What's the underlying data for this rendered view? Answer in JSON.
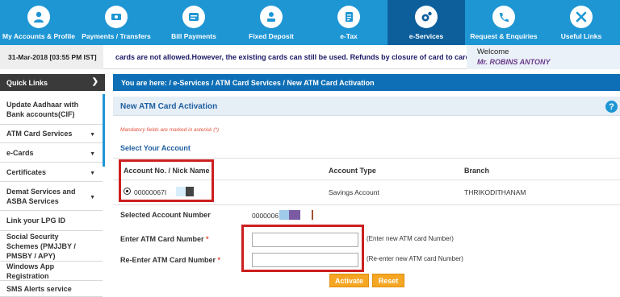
{
  "nav": [
    {
      "label": "My Accounts & Profile",
      "icon": "user-icon"
    },
    {
      "label": "Payments / Transfers",
      "icon": "money-transfer-icon"
    },
    {
      "label": "Bill Payments",
      "icon": "bill-icon"
    },
    {
      "label": "Fixed Deposit",
      "icon": "deposit-icon"
    },
    {
      "label": "e-Tax",
      "icon": "tax-document-icon"
    },
    {
      "label": "e-Services",
      "icon": "e-services-icon"
    },
    {
      "label": "Request & Enquiries",
      "icon": "phone-enquiry-icon"
    },
    {
      "label": "Useful Links",
      "icon": "links-icon"
    }
  ],
  "infobar": {
    "datetime": "31-Mar-2018 [03:55 PM IST]",
    "marquee": "cards are not allowed.However, the existing cards can still be used. Refunds by closure of card to card",
    "welcome_label": "Welcome",
    "user_name": "Mr. ROBINS ANTONY"
  },
  "sidebar": {
    "header": "Quick Links",
    "items": [
      {
        "label": "Update Aadhaar with Bank accounts(CIF)",
        "has_caret": false
      },
      {
        "label": "ATM Card Services",
        "has_caret": true
      },
      {
        "label": "e-Cards",
        "has_caret": true
      },
      {
        "label": "Certificates",
        "has_caret": true
      },
      {
        "label": "Demat Services and ASBA Services",
        "has_caret": true
      },
      {
        "label": "Link your LPG ID",
        "has_caret": false
      },
      {
        "label": "Social Security Schemes (PMJJBY / PMSBY / APY)",
        "has_caret": false
      },
      {
        "label": "Windows App Registration",
        "has_caret": false
      },
      {
        "label": "SMS Alerts service",
        "has_caret": false
      }
    ]
  },
  "breadcrumb": "You are here:  /  e-Services  /  ATM Card Services  /  New ATM Card Activation",
  "panel": {
    "title": "New ATM Card Activation",
    "help": "?",
    "mandatory_note": "Mandatory fields are marked in asterisk (*)",
    "select_account": "Select Your Account",
    "table": {
      "headers": [
        "Account No. / Nick Name",
        "Account Type",
        "Branch"
      ],
      "row": {
        "account": "00000067I",
        "type": "Savings Account",
        "branch": "THRIKODITHANAM"
      }
    },
    "selected_account_label": "Selected Account Number",
    "selected_account_value": "00000067",
    "enter_card_label": "Enter ATM Card Number",
    "enter_card_hint": "(Enter new ATM card Number)",
    "reenter_card_label": "Re-Enter ATM Card Number",
    "reenter_card_hint": "(Re-enter new ATM card Number)",
    "required_mark": "*",
    "activate_button": "Activate",
    "reset_button": "Reset"
  },
  "colors": {
    "nav_bg": "#1e96d4",
    "nav_active": "#0d5f9c",
    "breadcrumb_bg": "#0e6fb6",
    "button": "#f5a623",
    "highlight": "#cc1f1f"
  }
}
